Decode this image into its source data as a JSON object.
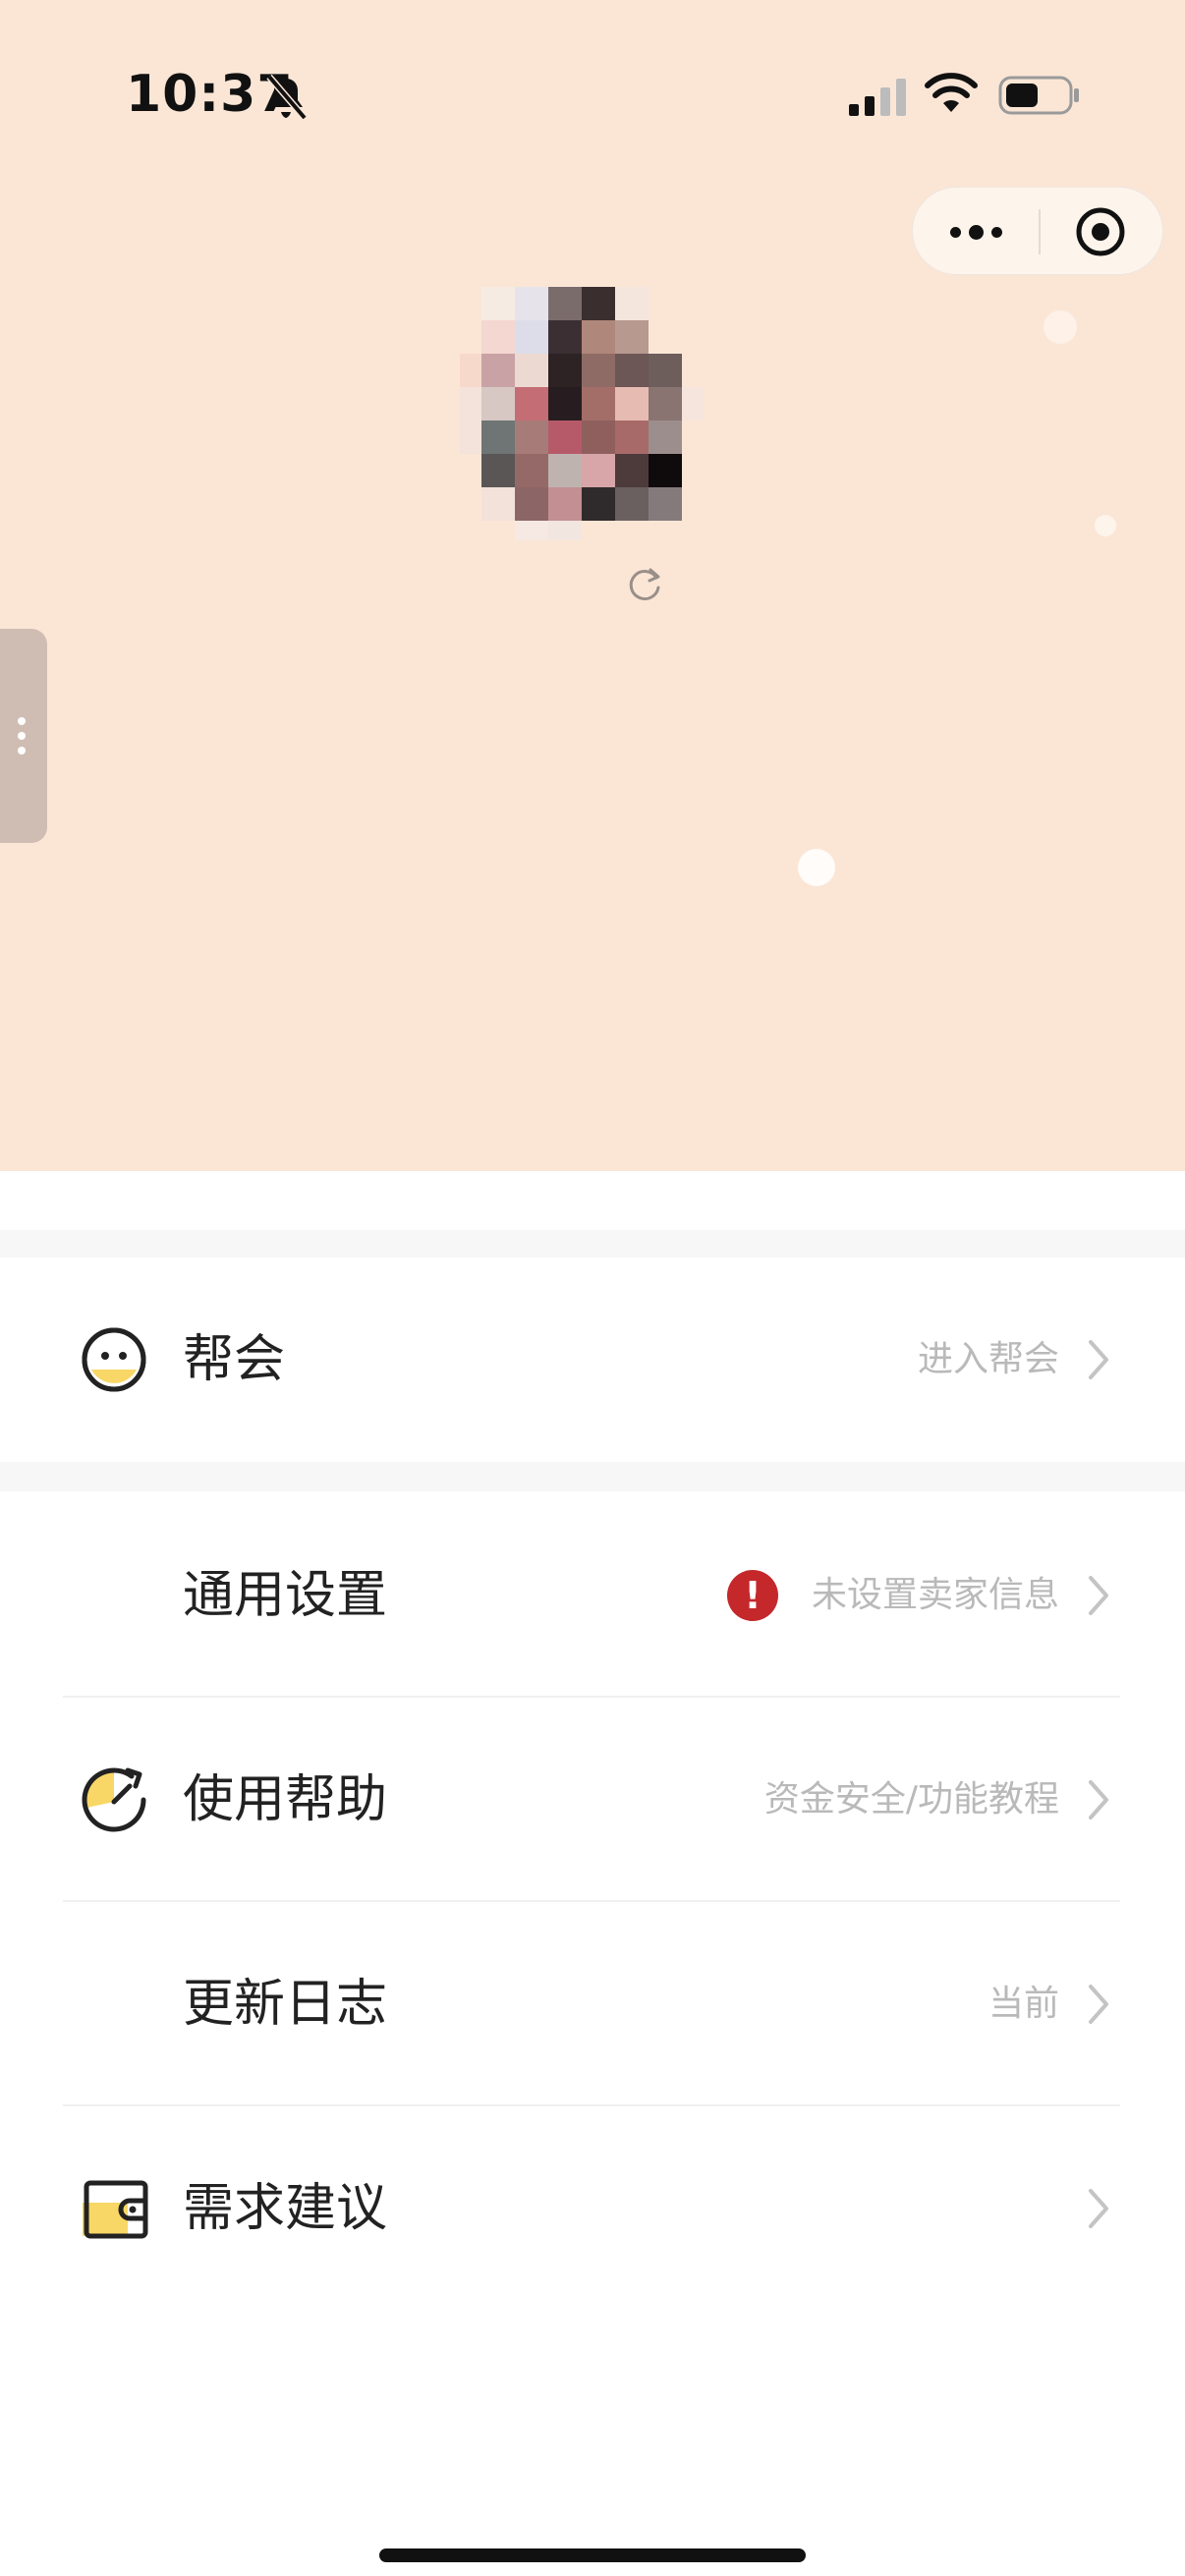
{
  "status_bar": {
    "time": "10:37"
  },
  "menu": {
    "guild": {
      "label": "帮会",
      "hint": "进入帮会"
    },
    "general_settings": {
      "label": "通用设置",
      "hint": "未设置卖家信息"
    },
    "help": {
      "label": "使用帮助",
      "hint": "资金安全/功能教程"
    },
    "changelog": {
      "label": "更新日志",
      "hint": "当前"
    },
    "feedback": {
      "label": "需求建议",
      "hint": ""
    }
  },
  "colors": {
    "hero_bg": "#fbe6d6",
    "accent_yellow": "#f8d766",
    "warning_red": "#c4282b",
    "hint_gray": "#b9b9b9"
  },
  "icons": {
    "guild": "smile-face-icon",
    "general_settings_warning": "exclamation-warning-icon",
    "help": "gauge-refresh-icon",
    "feedback": "wallet-icon",
    "chevron": "chevron-right-icon"
  }
}
